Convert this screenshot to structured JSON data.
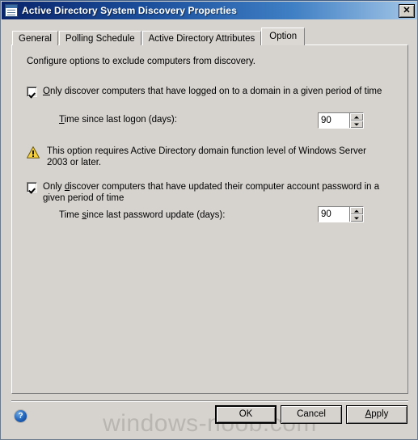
{
  "window": {
    "title": "Active Directory System Discovery Properties",
    "icon": "properties-window-icon",
    "close_label": "✕"
  },
  "tabs": [
    {
      "label": "General",
      "selected": false
    },
    {
      "label": "Polling Schedule",
      "selected": false
    },
    {
      "label": "Active Directory Attributes",
      "selected": false
    },
    {
      "label": "Option",
      "selected": true
    }
  ],
  "content": {
    "intro": "Configure options to exclude computers from discovery.",
    "option_logon": {
      "checked": true,
      "label_pre": "",
      "label_accel": "O",
      "label_post": "nly discover computers that have logged on to a domain in a given period of time",
      "full_label": "Only discover computers that have logged on to a domain in a given period of time",
      "field_label_pre": "",
      "field_label_accel": "T",
      "field_label_post": "ime since last logon (days):",
      "field_full_label": "Time since last logon (days):",
      "value": "90"
    },
    "warning": {
      "icon": "warning-triangle-icon",
      "text": "This option requires Active Directory domain function level of Windows Server 2003 or later."
    },
    "option_password": {
      "checked": true,
      "label_pre": "Only ",
      "label_accel": "d",
      "label_post": "iscover computers that have updated their computer account password in a given period of time",
      "full_label": "Only discover computers that have updated their computer account password in a given period of time",
      "field_label_pre": "Time ",
      "field_label_accel": "s",
      "field_label_post": "ince last password update (days):",
      "field_full_label": "Time since last password update (days):",
      "value": "90"
    }
  },
  "footer": {
    "help_glyph": "?",
    "ok_label": "OK",
    "cancel_label": "Cancel",
    "apply_accel": "A",
    "apply_rest": "pply",
    "apply_label": "Apply"
  },
  "watermark": "windows-noob.com",
  "colors": {
    "dialog_face": "#d6d3ce",
    "title_gradient_start": "#0a246a",
    "title_gradient_end": "#a6c8e8",
    "warning_yellow": "#f7d13d",
    "help_blue": "#1f62b8",
    "watermark_gray": "#b9b6b1"
  }
}
